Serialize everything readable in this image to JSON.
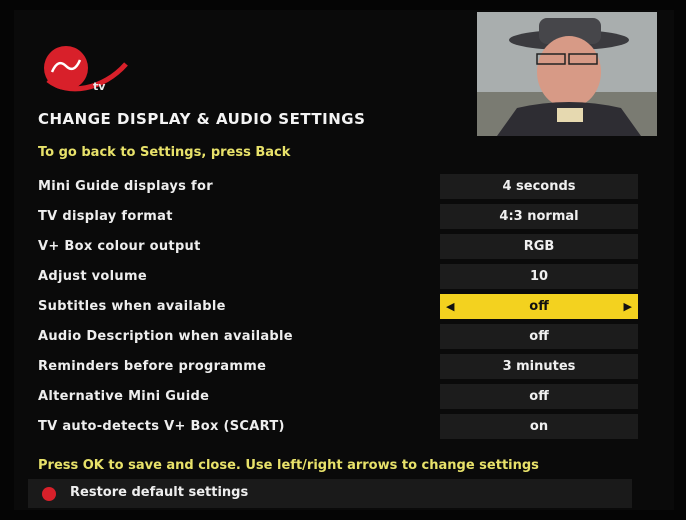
{
  "brand": {
    "tv_label": "tv"
  },
  "header": {
    "title": "CHANGE DISPLAY & AUDIO SETTINGS",
    "back_hint": "To go back to Settings, press Back"
  },
  "settings": [
    {
      "label": "Mini Guide displays for",
      "value": "4 seconds"
    },
    {
      "label": "TV display format",
      "value": "4:3 normal"
    },
    {
      "label": "V+ Box colour output",
      "value": "RGB"
    },
    {
      "label": "Adjust volume",
      "value": "10"
    },
    {
      "label": "Subtitles when available",
      "value": "off",
      "selected": true
    },
    {
      "label": "Audio Description when available",
      "value": "off"
    },
    {
      "label": "Reminders before programme",
      "value": "3 minutes"
    },
    {
      "label": "Alternative Mini Guide",
      "value": "off"
    },
    {
      "label": "TV auto-detects V+ Box (SCART)",
      "value": "on"
    }
  ],
  "footer": {
    "hint": "Press OK to save and close. Use left/right arrows to change settings",
    "restore_label": "Restore default settings"
  },
  "colors": {
    "accent_yellow": "#f3d21f",
    "hint_text": "#e8e26a",
    "brand_red": "#d8202a"
  },
  "icons": {
    "selected_left": "left-arrow-icon",
    "selected_right": "right-arrow-icon",
    "restore_button": "red-circle-icon"
  }
}
